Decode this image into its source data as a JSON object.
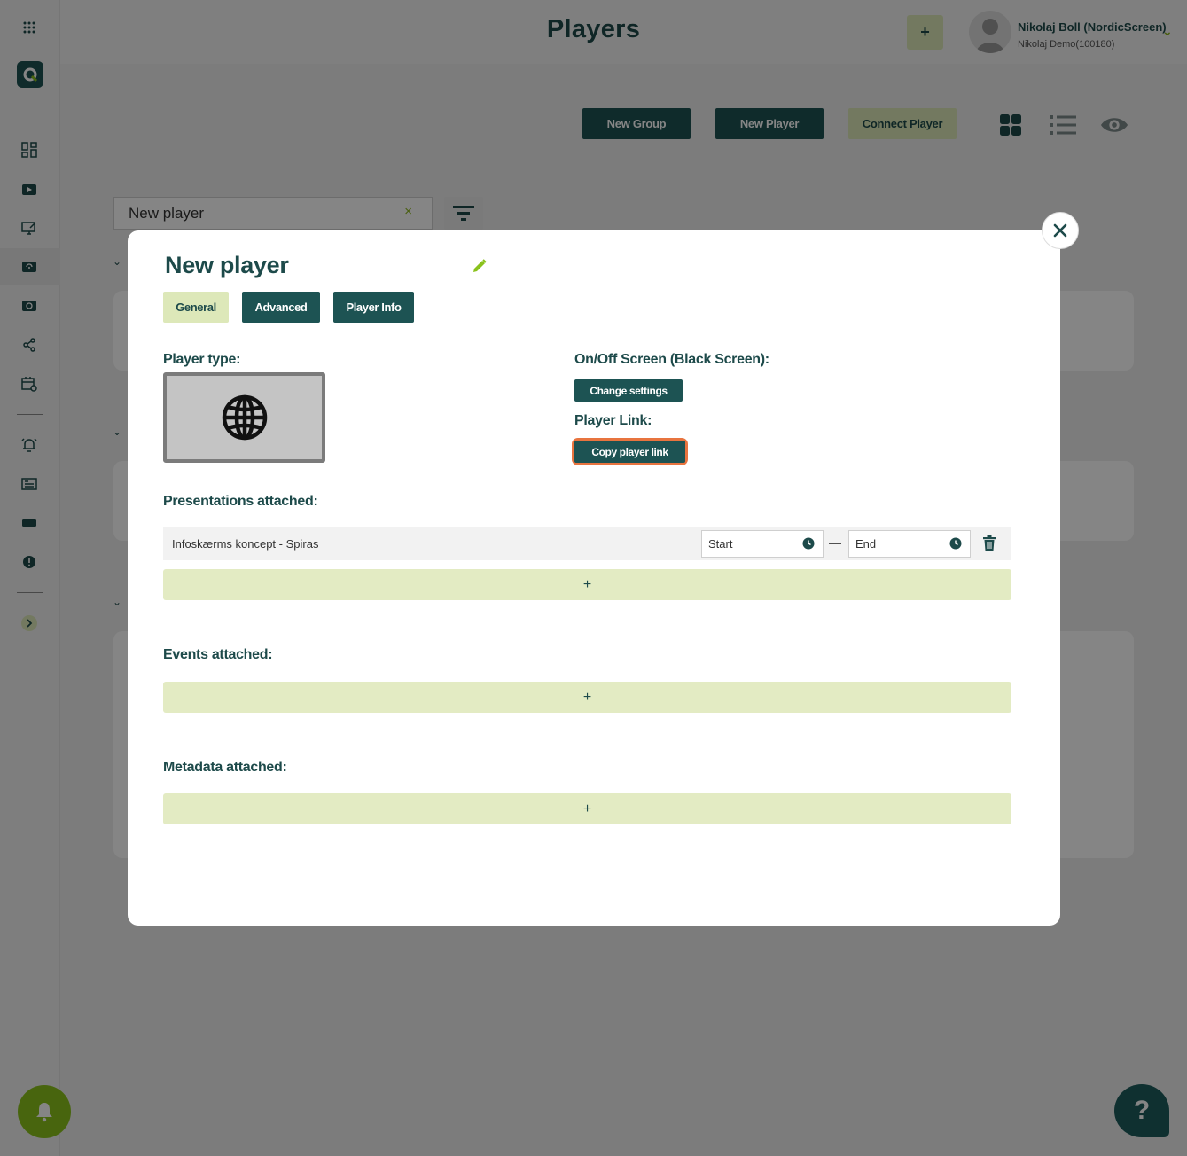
{
  "header": {
    "title": "Players",
    "add_label": "+",
    "user_name": "Nikolaj Boll (NordicScreen)",
    "user_sub": "Nikolaj Demo(100180)"
  },
  "toolbar": {
    "new_group": "New Group",
    "new_player": "New Player",
    "connect_player": "Connect Player"
  },
  "search": {
    "value": "New player",
    "clear": "×"
  },
  "help": {
    "label": "?"
  },
  "modal": {
    "title": "New player",
    "tabs": [
      {
        "label": "General",
        "active": true
      },
      {
        "label": "Advanced",
        "active": false
      },
      {
        "label": "Player Info",
        "active": false
      }
    ],
    "player_type_label": "Player type:",
    "player_type_icon": "globe-icon",
    "onoff_label": "On/Off Screen (Black Screen):",
    "change_settings": "Change settings",
    "player_link_label": "Player Link:",
    "copy_link": "Copy player link",
    "presentations_label": "Presentations attached:",
    "presentations": [
      {
        "name": "Infoskærms koncept - Spiras",
        "start_placeholder": "Start",
        "end_placeholder": "End"
      }
    ],
    "dash": "—",
    "add_label": "+",
    "events_label": "Events attached:",
    "metadata_label": "Metadata attached:"
  },
  "colors": {
    "brand_dark": "#1d5353",
    "brand_light": "#dde8b9",
    "accent_green": "#8ac21c",
    "focus_ring": "#e8743f"
  }
}
